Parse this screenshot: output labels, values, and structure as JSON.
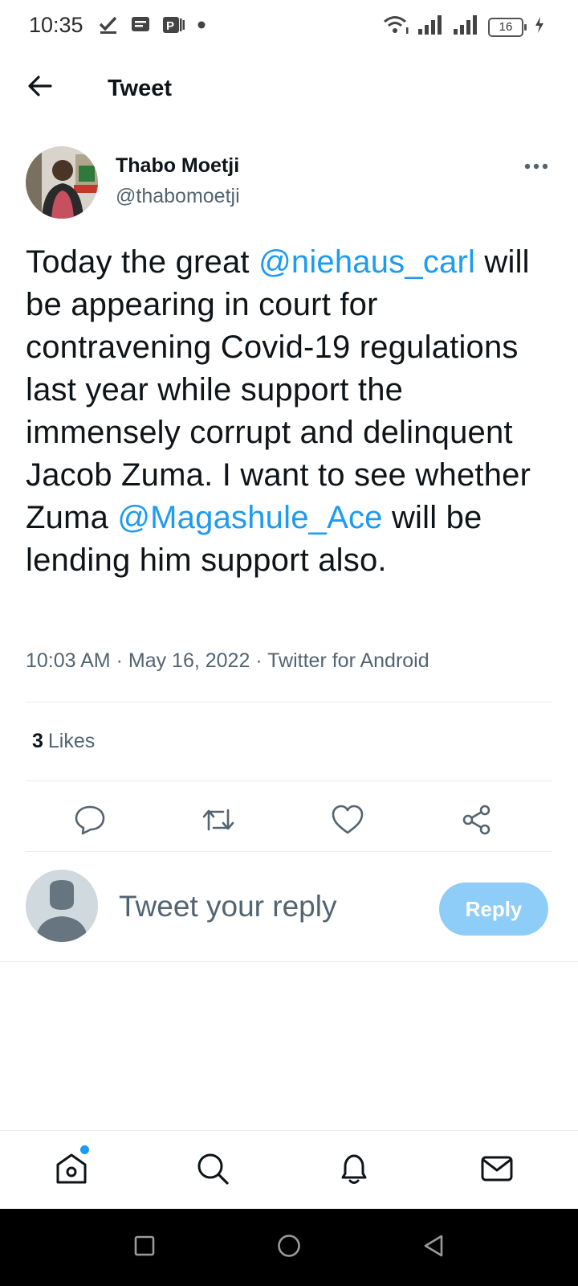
{
  "status_bar": {
    "time": "10:35",
    "battery_level": "16",
    "left_icons": [
      "check-icon",
      "message-icon",
      "app-notification-icon",
      "dot-icon"
    ],
    "right_icons": [
      "wifi-icon",
      "signal-icon",
      "signal-icon",
      "battery-icon",
      "charging-icon"
    ]
  },
  "header": {
    "title": "Tweet",
    "back_icon": "arrow-left-icon"
  },
  "tweet": {
    "author_name": "Thabo Moetji",
    "author_handle": "@thabomoetji",
    "text_parts": {
      "p1": "Today the great ",
      "mention1": "@niehaus_carl",
      "p2": " will be appearing in court for contravening Covid-19 regulations last year while support the immensely corrupt and delinquent Jacob Zuma. I want to see whether Zuma ",
      "mention2": "@Magashule_Ace",
      "p3": " will be lending him support also."
    },
    "time": "10:03 AM",
    "date": "May 16, 2022",
    "separator": "·",
    "source": "Twitter for Android",
    "likes_count": "3",
    "likes_label": "Likes"
  },
  "actions": [
    "reply-icon",
    "retweet-icon",
    "like-icon",
    "share-icon"
  ],
  "reply": {
    "placeholder": "Tweet your reply",
    "button_label": "Reply"
  },
  "bottom_nav": [
    "home-icon",
    "search-icon",
    "notifications-icon",
    "messages-icon"
  ],
  "colors": {
    "accent": "#1d9bf0",
    "reply_button": "#8ecdf8",
    "secondary_text": "#536471",
    "divider": "#e6ecf0"
  }
}
